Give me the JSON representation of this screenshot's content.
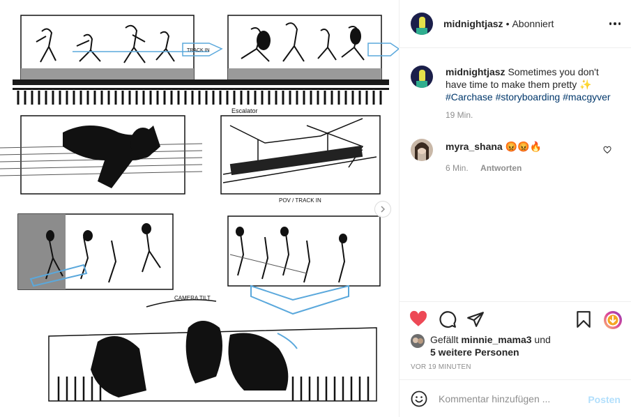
{
  "post": {
    "username": "midnightjasz",
    "separator": "•",
    "follow_status": "Abonniert",
    "more_icon": "more-horizontal-icon"
  },
  "caption": {
    "username": "midnightjasz",
    "text": "Sometimes you don't have time to make them pretty ✨",
    "hashtags": [
      "#Carchase",
      "#storyboarding",
      "#macgyver"
    ],
    "time": "19 Min."
  },
  "comments": [
    {
      "username": "myra_shana",
      "text": "😡😡🔥",
      "time": "6 Min.",
      "reply_label": "Antworten"
    }
  ],
  "actions": {
    "like_icon": "heart-filled-icon",
    "comment_icon": "speech-bubble-icon",
    "share_icon": "paper-plane-icon",
    "save_icon": "bookmark-icon",
    "boost_icon": "download-circle-icon",
    "like_color": "#ed4956"
  },
  "likes": {
    "prefix": "Gefällt",
    "first_user": "minnie_mama3",
    "conjunction": "und",
    "others": "5 weitere Personen"
  },
  "timestamp": "VOR 19 MINUTEN",
  "add_comment": {
    "placeholder": "Kommentar hinzufügen ...",
    "post_label": "Posten",
    "emoji_icon": "smiley-icon"
  },
  "colors": {
    "accent_link": "#00376b",
    "muted": "#8e8e8e",
    "post_disabled": "#b2dffc",
    "arrow_blue": "#5aa8dc"
  }
}
